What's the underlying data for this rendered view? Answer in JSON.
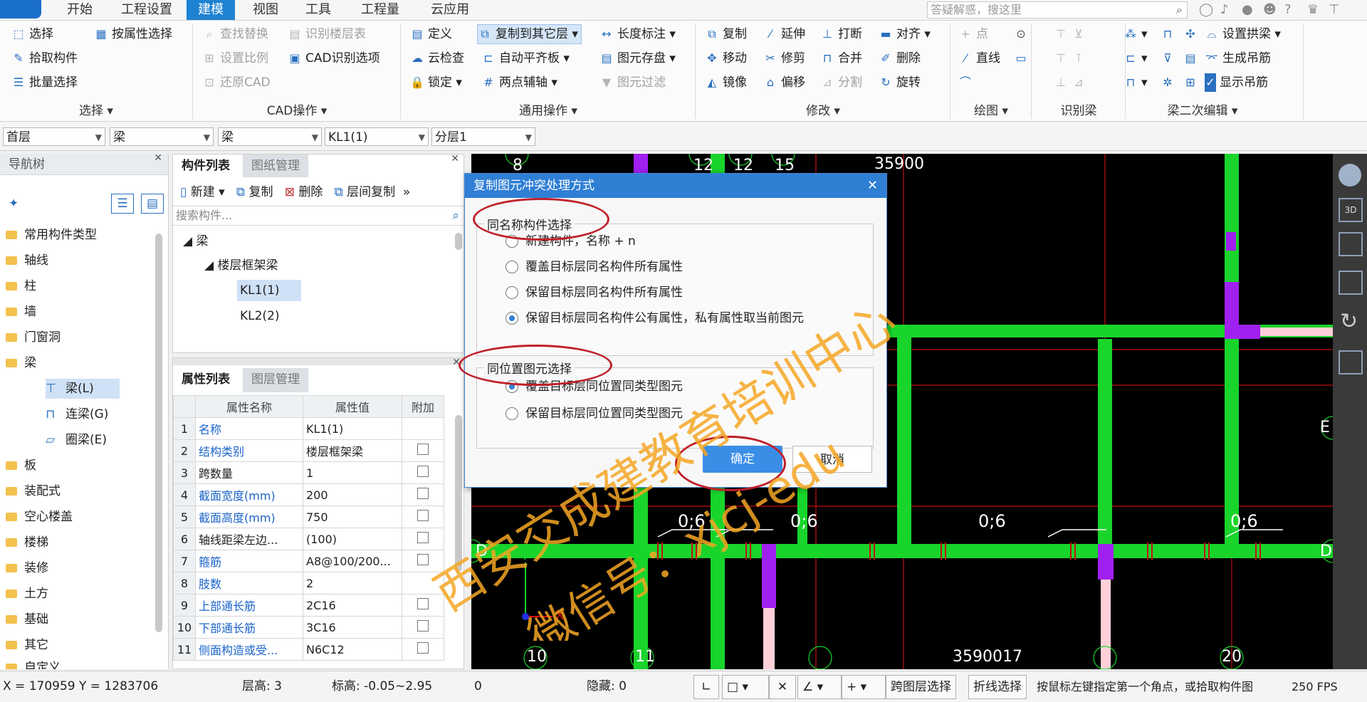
{
  "menu": {
    "tabs": [
      "开始",
      "工程设置",
      "建模",
      "视图",
      "工具",
      "工程量",
      "云应用"
    ],
    "active": "建模",
    "search_placeholder": "答疑解惑，搜这里",
    "help_label": "?"
  },
  "ribbon": {
    "select": {
      "label": "选择",
      "items": [
        "选择",
        "按属性选择",
        "拾取构件",
        "批量选择"
      ]
    },
    "cad": {
      "label": "CAD操作",
      "items": [
        "查找替换",
        "识别楼层表",
        "设置比例",
        "CAD识别选项",
        "还原CAD"
      ]
    },
    "common": {
      "label": "通用操作",
      "items": [
        "定义",
        "复制到其它层",
        "长度标注",
        "云检查",
        "自动平齐板",
        "图元存盘",
        "锁定",
        "两点辅轴",
        "图元过滤"
      ]
    },
    "modify": {
      "label": "修改",
      "items": [
        "复制",
        "延伸",
        "打断",
        "对齐",
        "移动",
        "修剪",
        "合并",
        "删除",
        "镜像",
        "偏移",
        "分割",
        "旋转"
      ]
    },
    "draw": {
      "label": "绘图",
      "items": [
        "点",
        "直线"
      ]
    },
    "identify": {
      "label": "识别梁"
    },
    "beam2": {
      "label": "梁二次编辑",
      "items": [
        "设置拱梁",
        "生成吊筋",
        "显示吊筋"
      ]
    }
  },
  "combos": [
    "首层",
    "梁",
    "梁",
    "KL1(1)",
    "分层1"
  ],
  "navtree": {
    "title": "导航树",
    "items": [
      "常用构件类型",
      "轴线",
      "柱",
      "墙",
      "门窗洞",
      "梁",
      "板",
      "装配式",
      "空心楼盖",
      "楼梯",
      "装修",
      "土方",
      "基础",
      "其它",
      "自定义"
    ],
    "beam_children": [
      "梁(L)",
      "连梁(G)",
      "圈梁(E)"
    ]
  },
  "complist": {
    "tabs": [
      "构件列表",
      "图纸管理"
    ],
    "toolbar": [
      "新建",
      "复制",
      "删除",
      "层间复制"
    ],
    "search_placeholder": "搜索构件...",
    "tree_root": "梁",
    "tree_group": "楼层框架梁",
    "tree_items": [
      "KL1(1)",
      "KL2(2)"
    ]
  },
  "props": {
    "tabs": [
      "属性列表",
      "图层管理"
    ],
    "headers": [
      "属性名称",
      "属性值",
      "附加"
    ],
    "rows": [
      {
        "n": "1",
        "name": "名称",
        "value": "KL1(1)",
        "blue": true,
        "cb": false
      },
      {
        "n": "2",
        "name": "结构类别",
        "value": "楼层框架梁",
        "blue": true,
        "cb": true
      },
      {
        "n": "3",
        "name": "跨数量",
        "value": "1",
        "blue": false,
        "cb": true
      },
      {
        "n": "4",
        "name": "截面宽度(mm)",
        "value": "200",
        "blue": true,
        "cb": true
      },
      {
        "n": "5",
        "name": "截面高度(mm)",
        "value": "750",
        "blue": true,
        "cb": true
      },
      {
        "n": "6",
        "name": "轴线距梁左边...",
        "value": "(100)",
        "blue": false,
        "cb": true
      },
      {
        "n": "7",
        "name": "箍筋",
        "value": "A8@100/200...",
        "blue": true,
        "cb": true
      },
      {
        "n": "8",
        "name": "肢数",
        "value": "2",
        "blue": true,
        "cb": false
      },
      {
        "n": "9",
        "name": "上部通长筋",
        "value": "2C16",
        "blue": true,
        "cb": true
      },
      {
        "n": "10",
        "name": "下部通长筋",
        "value": "3C16",
        "blue": true,
        "cb": true
      },
      {
        "n": "11",
        "name": "侧面构造或受...",
        "value": "N6C12",
        "blue": true,
        "cb": true
      }
    ]
  },
  "canvas": {
    "labels_top": [
      "8",
      "12",
      "12",
      "15",
      "35900"
    ],
    "labels_bottom": [
      "10",
      "11",
      "3590017",
      "20"
    ],
    "span_label": "0;6",
    "axis_labels": [
      "E",
      "D",
      "D"
    ],
    "axis_x": "X",
    "axis_y": "Y"
  },
  "dialog": {
    "title": "复制图元冲突处理方式",
    "group1": {
      "legend": "同名称构件选择",
      "options": [
        "新建构件，名称 + n",
        "覆盖目标层同名构件所有属性",
        "保留目标层同名构件所有属性",
        "保留目标层同名构件公有属性，私有属性取当前图元"
      ],
      "selected": 3
    },
    "group2": {
      "legend": "同位置图元选择",
      "options": [
        "覆盖目标层同位置同类型图元",
        "保留目标层同位置同类型图元"
      ],
      "selected": 0
    },
    "ok_label": "确定",
    "cancel_label": "取消"
  },
  "watermark": {
    "line1": "西安交成建教育培训中心",
    "line2": "微信号：xjcj-edu"
  },
  "status": {
    "coords": "X = 170959 Y = 1283706",
    "floor_height": "层高:   3",
    "elevation": "标高:   -0.05~2.95",
    "zero": "0",
    "hidden": "隐藏:  0",
    "cross_layer": "跨图层选择",
    "polyline": "折线选择",
    "hint": "按鼠标左键指定第一个角点，或拾取构件图",
    "fps": "250 FPS"
  },
  "colors": {
    "accent": "#1e82d2",
    "beam": "#19d42b",
    "column": "#a020f0",
    "grid": "#d01010",
    "highlight": "#c0202a",
    "watermark": "#f5a623"
  }
}
